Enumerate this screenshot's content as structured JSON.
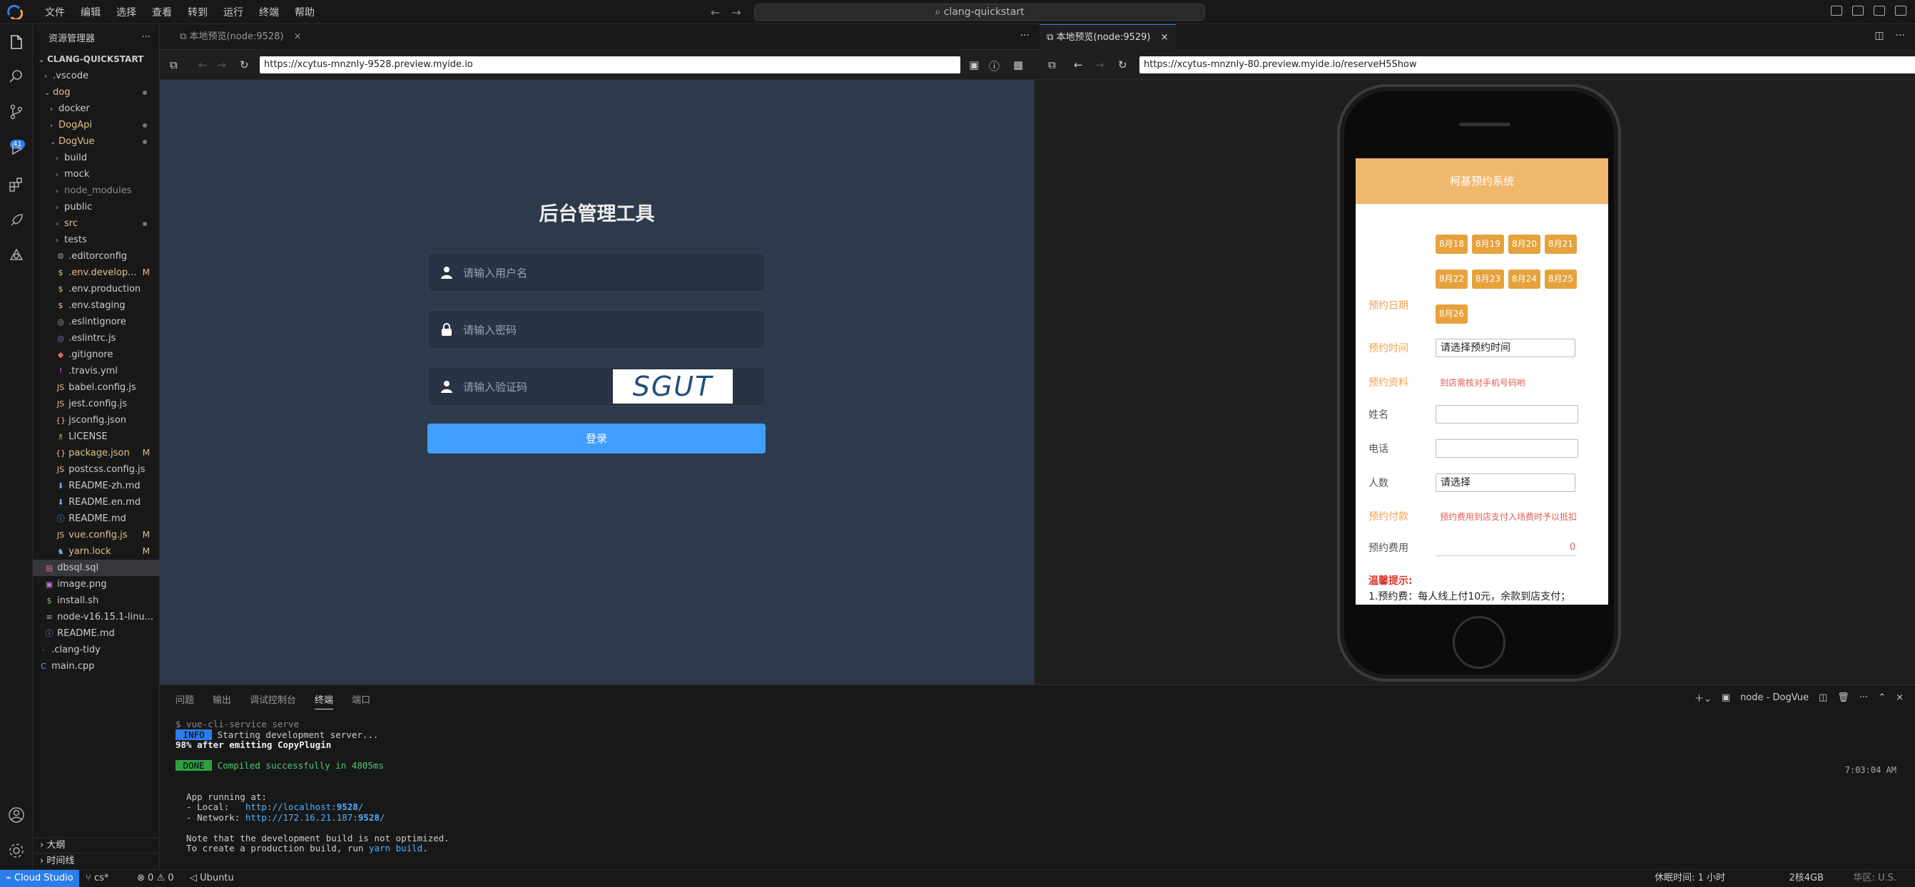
{
  "menu": [
    "文件",
    "编辑",
    "选择",
    "查看",
    "转到",
    "运行",
    "终端",
    "帮助"
  ],
  "command_center": "clang-quickstart",
  "activity_badge": "41",
  "explorer": {
    "title": "资源管理器",
    "root": "CLANG-QUICKSTART",
    "items": [
      {
        "label": ".vscode",
        "decoration": ""
      },
      {
        "label": "dog",
        "decoration": ""
      },
      {
        "label": "docker",
        "decoration": ""
      },
      {
        "label": "DogApi",
        "decoration": ""
      },
      {
        "label": "DogVue",
        "decoration": ""
      },
      {
        "label": "build",
        "decoration": ""
      },
      {
        "label": "mock",
        "decoration": ""
      },
      {
        "label": "node_modules",
        "decoration": ""
      },
      {
        "label": "public",
        "decoration": ""
      },
      {
        "label": "src",
        "decoration": ""
      },
      {
        "label": "tests",
        "decoration": ""
      },
      {
        "label": ".editorconfig",
        "decoration": ""
      },
      {
        "label": ".env.develop...",
        "decoration": "M"
      },
      {
        "label": ".env.production",
        "decoration": ""
      },
      {
        "label": ".env.staging",
        "decoration": ""
      },
      {
        "label": ".eslintignore",
        "decoration": ""
      },
      {
        "label": ".eslintrc.js",
        "decoration": ""
      },
      {
        "label": ".gitignore",
        "decoration": ""
      },
      {
        "label": ".travis.yml",
        "decoration": ""
      },
      {
        "label": "babel.config.js",
        "decoration": ""
      },
      {
        "label": "jest.config.js",
        "decoration": ""
      },
      {
        "label": "jsconfig.json",
        "decoration": ""
      },
      {
        "label": "LICENSE",
        "decoration": ""
      },
      {
        "label": "package.json",
        "decoration": "M"
      },
      {
        "label": "postcss.config.js",
        "decoration": ""
      },
      {
        "label": "README-zh.md",
        "decoration": ""
      },
      {
        "label": "README.en.md",
        "decoration": ""
      },
      {
        "label": "README.md",
        "decoration": ""
      },
      {
        "label": "vue.config.js",
        "decoration": "M"
      },
      {
        "label": "yarn.lock",
        "decoration": "M"
      },
      {
        "label": "dbsql.sql",
        "decoration": ""
      },
      {
        "label": "image.png",
        "decoration": ""
      },
      {
        "label": "install.sh",
        "decoration": ""
      },
      {
        "label": "node-v16.15.1-linu...",
        "decoration": ""
      },
      {
        "label": "README.md",
        "decoration": ""
      },
      {
        "label": ".clang-tidy",
        "decoration": ""
      },
      {
        "label": "main.cpp",
        "decoration": ""
      }
    ],
    "outline": "大纲",
    "timeline": "时间线"
  },
  "left_preview": {
    "tab": "本地预览(node:9528)",
    "url": "https://xcytus-mnznly-9528.preview.myide.io",
    "title": "后台管理工具",
    "username_placeholder": "请输入用户名",
    "password_placeholder": "请输入密码",
    "captcha_placeholder": "请输入验证码",
    "captcha_text": "SGUT",
    "login_button": "登录"
  },
  "right_preview": {
    "tab": "本地预览(node:9529)",
    "url": "https://xcytus-mnznly-80.preview.myide.io/reserveH5Show",
    "header": "柯基预约系统",
    "dates": [
      "8月18",
      "8月19",
      "8月20",
      "8月21",
      "8月22",
      "8月23",
      "8月24",
      "8月25",
      "8月26"
    ],
    "label_date": "预约日期",
    "label_time": "预约时间",
    "time_value": "请选择预约时间",
    "label_info": "预约资料",
    "info_note": "到店需核对手机号码哟",
    "label_name": "姓名",
    "label_phone": "电话",
    "label_count": "人数",
    "count_value": "请选择",
    "label_pay": "预约付款",
    "pay_note": "预约费用到店支付入场费时予以抵扣",
    "label_fee": "预约费用",
    "fee_value": "0",
    "tips_title": "温馨提示:",
    "tips_line": "1.预约费：每人线上付10元，余款到店支付；"
  },
  "panel": {
    "tabs": [
      "问题",
      "输出",
      "调试控制台",
      "终端",
      "端口"
    ],
    "active_tab": "终端",
    "terminal_name": "node - DogVue",
    "lines": {
      "cmd": "$ vue-cli-service serve",
      "info_tag": " INFO ",
      "info_text": " Starting development server...",
      "progress": "98% after emitting CopyPlugin",
      "done_tag": " DONE ",
      "done_text": " Compiled successfully in 4805ms",
      "running": "  App running at:",
      "local_label": "  - Local:   ",
      "local_url": "http://localhost:",
      "local_port": "9528",
      "network_label": "  - Network: ",
      "network_url": "http://172.16.21.187:",
      "network_port": "9528",
      "note1": "  Note that the development build is not optimized.",
      "note2_pre": "  To create a production build, run ",
      "note2_cmd": "yarn build",
      "note2_post": "."
    },
    "time": "7:03:04 AM"
  },
  "statusbar": {
    "remote": "Cloud Studio",
    "branch": "cs*",
    "problems": "⊗ 0 ⚠ 0",
    "env": "Ubuntu",
    "rest": "休眠时间: 1 小时",
    "cpu": "2核4GB",
    "region": "华区: U.S."
  },
  "colors": {
    "accent": "#2b7de9",
    "login_bg": "#2d3a4b",
    "login_button": "#409eff",
    "phone_header": "#f0b86c",
    "date_chip": "#e6a23c"
  }
}
